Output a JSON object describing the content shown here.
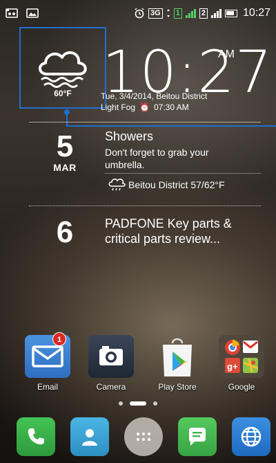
{
  "status_bar": {
    "time": "10:27",
    "sim1": "1",
    "sim2": "2",
    "network": "3G",
    "icons": [
      "scales-icon",
      "image-icon",
      "alarm-icon",
      "network-3g-icon",
      "sim1-icon",
      "signal-icon",
      "sim2-icon",
      "signal-icon",
      "battery-icon"
    ],
    "accent_green": "#55d36a"
  },
  "weather_widget": {
    "temperature": "60°F",
    "clock_time": "10:27",
    "ampm": "AM",
    "date_location": "Tue, 3/4/2014, Beitou District",
    "condition": "Light Fog",
    "alarm": "07:30 AM",
    "highlight_color": "#1f6fd0"
  },
  "events": [
    {
      "day": "5",
      "month": "MAR",
      "title": "Showers",
      "subtitle": "Don't forget to grab your umbrella.",
      "weather_location": "Beitou District",
      "weather_range": "57/62°F"
    },
    {
      "day": "6",
      "month": "",
      "title": "PADFONE Key parts & critical parts review..."
    }
  ],
  "apps": [
    {
      "label": "Email",
      "badge": "1",
      "icon": "email-icon",
      "color": "#3f86d6"
    },
    {
      "label": "Camera",
      "icon": "camera-icon",
      "color": "#2e3a4a"
    },
    {
      "label": "Play Store",
      "icon": "play-store-icon",
      "color": "#ffffff"
    },
    {
      "label": "Google",
      "icon": "google-folder-icon",
      "color": "#4a4038"
    }
  ],
  "page_indicator": {
    "pages": 3,
    "current": 2
  },
  "dock": [
    {
      "icon": "phone-icon",
      "color": "#3bb54a"
    },
    {
      "icon": "contacts-icon",
      "color": "#3aa7d7"
    },
    {
      "icon": "app-drawer-icon",
      "color": "#c8c3bc"
    },
    {
      "icon": "messaging-icon",
      "color": "#4cbf56"
    },
    {
      "icon": "browser-icon",
      "color": "#2a7fd6"
    }
  ]
}
